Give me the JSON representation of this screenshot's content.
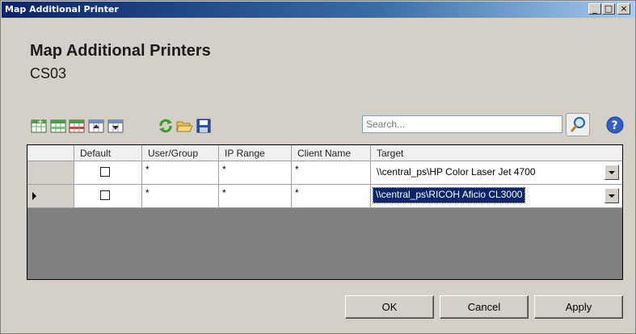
{
  "window": {
    "title": "Map Additional Printer",
    "controls": {
      "minimize": "_",
      "maximize": "□",
      "close": "×"
    }
  },
  "header": {
    "title": "Map Additional Printers",
    "subtitle": "CS03"
  },
  "toolbar": {
    "items": [
      "add-row-icon",
      "add-row-copy-icon",
      "delete-row-icon",
      "move-up-icon",
      "move-down-icon",
      "refresh-icon",
      "open-folder-icon",
      "save-icon"
    ]
  },
  "search": {
    "placeholder": "Search..."
  },
  "grid": {
    "columns": [
      "Default",
      "User/Group",
      "IP Range",
      "Client Name",
      "Target"
    ],
    "rows": [
      {
        "default": false,
        "user_group": "*",
        "ip_range": "*",
        "client_name": "*",
        "target": "\\\\central_ps\\HP Color Laser Jet 4700",
        "selected": false
      },
      {
        "default": false,
        "user_group": "*",
        "ip_range": "*",
        "client_name": "*",
        "target": "\\\\central_ps\\RICOH Aficio CL3000",
        "selected": true
      }
    ]
  },
  "buttons": {
    "ok": "OK",
    "cancel": "Cancel",
    "apply": "Apply"
  },
  "colors": {
    "titlebar": "#0a246a",
    "selection": "#0a246a",
    "face": "#d4d0c8"
  }
}
